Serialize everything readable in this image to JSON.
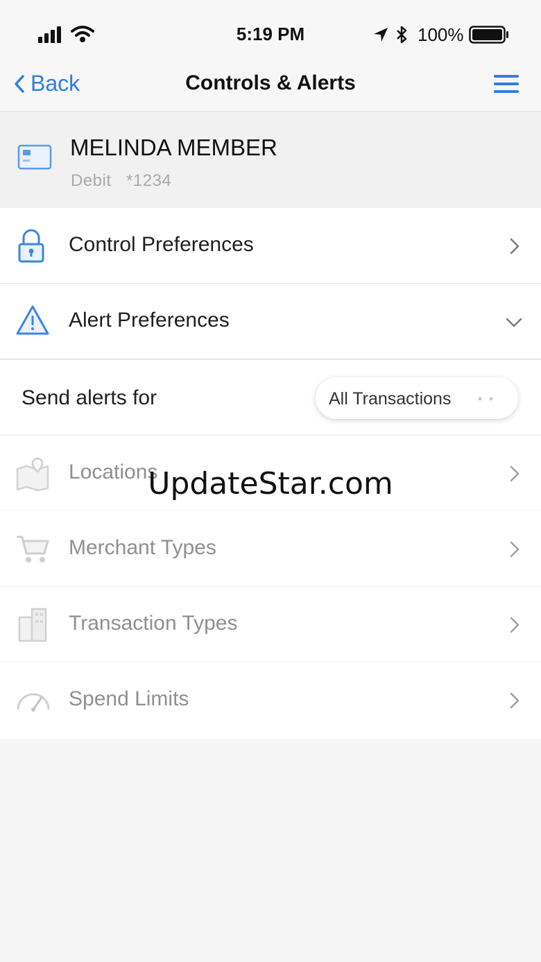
{
  "status_bar": {
    "time": "5:19 PM",
    "battery": "100%",
    "icons": [
      "signal-icon",
      "wifi-icon",
      "location-arrow-icon",
      "bluetooth-icon",
      "battery-icon"
    ]
  },
  "nav": {
    "back_label": "Back",
    "title": "Controls & Alerts",
    "menu_icon": "hamburger-menu-icon",
    "accent_color": "#2f7de1"
  },
  "card": {
    "holder_name": "MELINDA MEMBER",
    "type": "Debit",
    "number": "*1234",
    "icon": "credit-card-icon"
  },
  "sections": {
    "control_preferences": {
      "label": "Control Preferences",
      "icon": "lock-icon"
    },
    "alert_preferences": {
      "label": "Alert Preferences",
      "icon": "warning-triangle-icon"
    }
  },
  "send_alerts": {
    "label": "Send alerts for",
    "selected": "All Transactions"
  },
  "alert_items": [
    {
      "label": "Locations",
      "icon": "map-pin-icon"
    },
    {
      "label": "Merchant Types",
      "icon": "shopping-cart-icon"
    },
    {
      "label": "Transaction Types",
      "icon": "buildings-icon"
    },
    {
      "label": "Spend Limits",
      "icon": "speedometer-icon"
    }
  ],
  "watermark": "UpdateStar.com"
}
